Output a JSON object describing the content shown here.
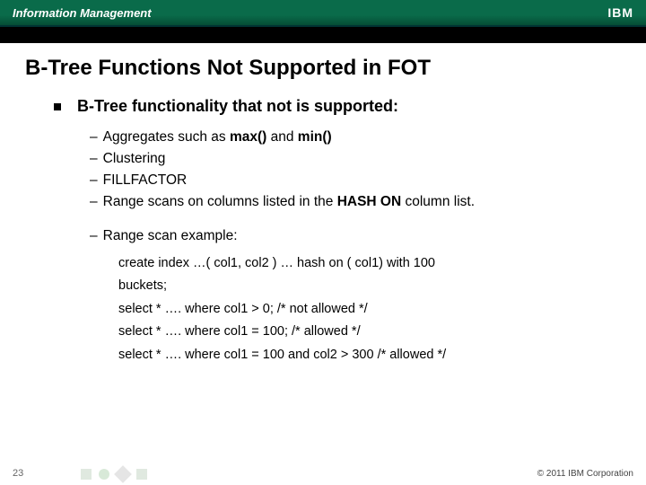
{
  "header": {
    "brand": "Information Management",
    "logo_text": "IBM"
  },
  "title": "B-Tree Functions Not Supported in FOT",
  "intro": "B-Tree functionality that not is supported:",
  "bullets": {
    "b0_pre": "Aggregates such as ",
    "b0_max": "max()",
    "b0_mid": " and ",
    "b0_min": "min()",
    "b1": "Clustering",
    "b2": "FILLFACTOR",
    "b3_pre": "Range scans on columns listed in the ",
    "b3_hash": "HASH ON",
    "b3_post": " column list.",
    "b4": "Range scan example:"
  },
  "code": {
    "l1a": "create index …( col1, col2 ) … hash on ( col1) with 100",
    "l1b": "buckets;",
    "l2": "select * ….  where col1 > 0;   /* not allowed */",
    "l3": "select * ….  where col1 = 100; /* allowed */",
    "l4": "select * ….  where col1 = 100 and col2 > 300 /* allowed */"
  },
  "footer": {
    "page": "23",
    "copyright": "© 2011 IBM Corporation"
  }
}
